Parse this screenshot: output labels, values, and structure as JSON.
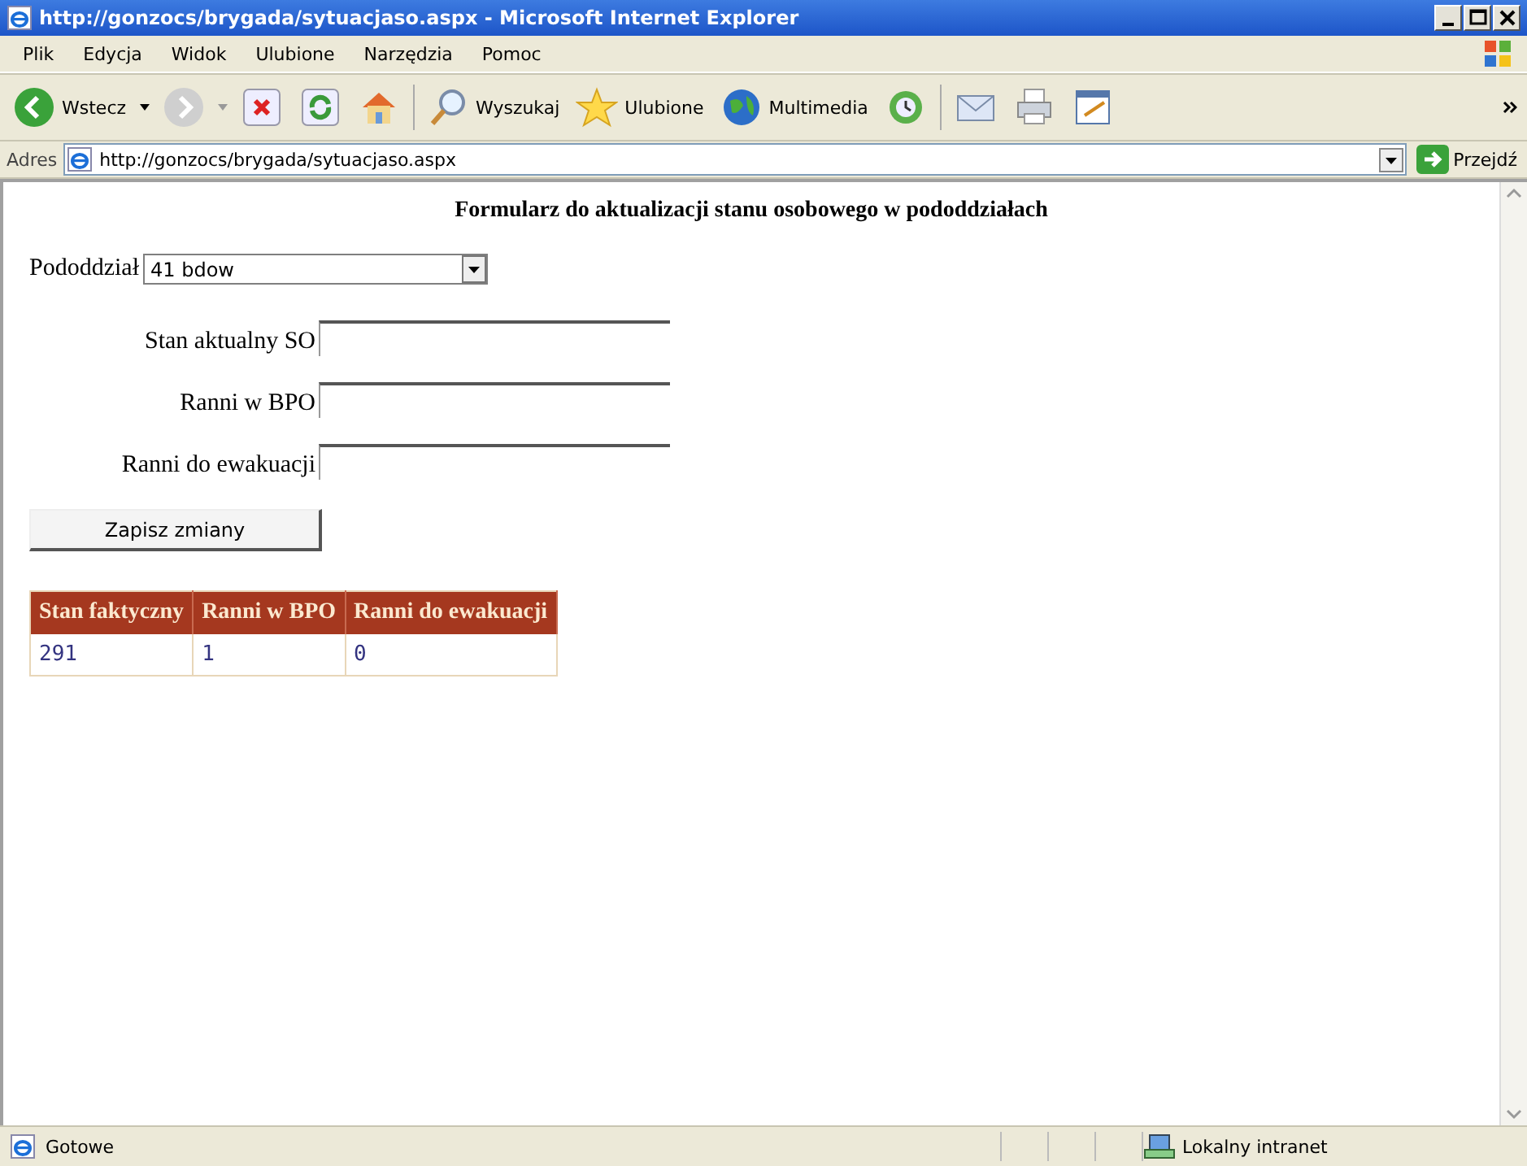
{
  "window": {
    "title": "http://gonzocs/brygada/sytuacjaso.aspx - Microsoft Internet Explorer"
  },
  "menu": [
    "Plik",
    "Edycja",
    "Widok",
    "Ulubione",
    "Narzędzia",
    "Pomoc"
  ],
  "toolbar": [
    {
      "kind": "back",
      "label": "Wstecz"
    },
    {
      "kind": "forward"
    },
    {
      "kind": "stop"
    },
    {
      "kind": "refresh"
    },
    {
      "kind": "home"
    },
    {
      "kind": "search",
      "label": "Wyszukaj"
    },
    {
      "kind": "favorites",
      "label": "Ulubione"
    },
    {
      "kind": "media",
      "label": "Multimedia"
    },
    {
      "kind": "history"
    },
    {
      "kind": "mail"
    },
    {
      "kind": "print"
    },
    {
      "kind": "edit"
    }
  ],
  "address": {
    "label": "Adres",
    "value": "http://gonzocs/brygada/sytuacjaso.aspx",
    "go": "Przejdź"
  },
  "form": {
    "title": "Formularz do aktualizacji stanu osobowego w pododdziałach",
    "unit": {
      "label": "Pododdział",
      "value": "41 bdow"
    },
    "fields": [
      {
        "label": "Stan aktualny SO"
      },
      {
        "label": "Ranni w BPO"
      },
      {
        "label": "Ranni do ewakuacji"
      }
    ],
    "submit": "Zapisz zmiany"
  },
  "table": {
    "columns": [
      "Stan faktyczny",
      "Ranni w BPO",
      "Ranni do ewakuacji"
    ],
    "rows": [
      [
        "291",
        "1",
        "0"
      ]
    ]
  },
  "status_bar": {
    "text": "Gotowe",
    "zone": "Lokalny intranet"
  }
}
